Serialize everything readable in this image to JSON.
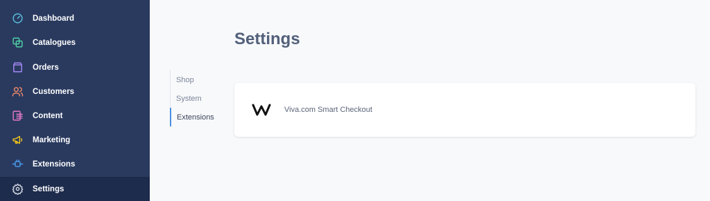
{
  "sidebar": {
    "items": [
      {
        "label": "Dashboard",
        "icon": "dashboard-gauge-icon",
        "color": "#5bc0de"
      },
      {
        "label": "Catalogues",
        "icon": "catalogue-copy-icon",
        "color": "#4fd1a5"
      },
      {
        "label": "Orders",
        "icon": "shopping-bag-icon",
        "color": "#a78bfa"
      },
      {
        "label": "Customers",
        "icon": "users-icon",
        "color": "#f08a6a"
      },
      {
        "label": "Content",
        "icon": "content-list-icon",
        "color": "#e879c9"
      },
      {
        "label": "Marketing",
        "icon": "megaphone-icon",
        "color": "#f5c518"
      },
      {
        "label": "Extensions",
        "icon": "plug-icon",
        "color": "#4a9df0"
      },
      {
        "label": "Settings",
        "icon": "gear-icon",
        "color": "#d0d6e2",
        "active": true
      }
    ],
    "background": "#2a3a5f",
    "active_background": "#1d2b4c"
  },
  "main": {
    "title": "Settings",
    "subnav": [
      {
        "label": "Shop"
      },
      {
        "label": "System"
      },
      {
        "label": "Extensions",
        "active": true
      }
    ],
    "extensions": [
      {
        "name": "Viva.com Smart Checkout",
        "logo": "viva-logo-icon"
      }
    ],
    "accent": "#4a90e2"
  }
}
